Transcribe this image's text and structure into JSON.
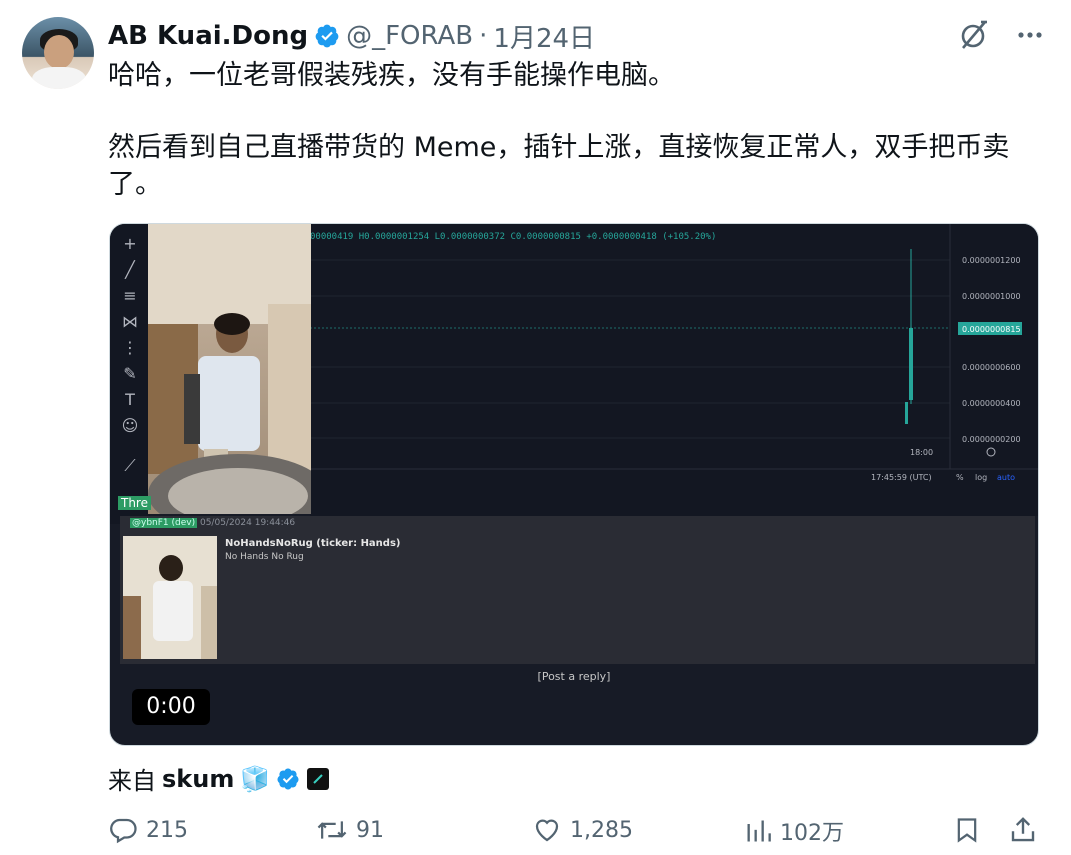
{
  "tweet": {
    "author_name": "AB Kuai.Dong",
    "handle": "@_FORAB",
    "separator": "·",
    "date": "1月24日",
    "text_line1": "哈哈，一位老哥假装残疾，没有手能操作电脑。",
    "text_line2": "然后看到自己直播带货的 Meme，插针上涨，直接恢复正常人，双手把币卖",
    "text_line3": "了。"
  },
  "media": {
    "ohlc_text": "00000419 H0.0000001254 L0.0000000372 C0.0000000815 +0.0000000418 (+105.20%)",
    "price_axis": [
      "0.0000001200",
      "0.0000001000",
      "0.0000000815",
      "0.0000000600",
      "0.0000000400",
      "0.0000000200"
    ],
    "time_label": "18:00",
    "clock": "17:45:59 (UTC)",
    "pct_label": "%",
    "log_label": "log",
    "auto_label": "auto",
    "thread_label": "Thre",
    "meta_user": "@ybnF1 (dev)",
    "meta_date": "05/05/2024 19:44:46",
    "post_title": "NoHandsNoRug (ticker: Hands)",
    "post_sub": "No Hands No Rug",
    "post_reply": "[Post a reply]",
    "video_time": "0:00"
  },
  "source": {
    "prefix": "来自",
    "name": "skum",
    "emoji": "🧊"
  },
  "actions": {
    "replies": "215",
    "retweets": "91",
    "likes": "1,285",
    "views": "102万"
  },
  "colors": {
    "verified": "#1d9bf0",
    "muted": "#536471",
    "chart_bg": "#131722",
    "up": "#26a69a"
  }
}
